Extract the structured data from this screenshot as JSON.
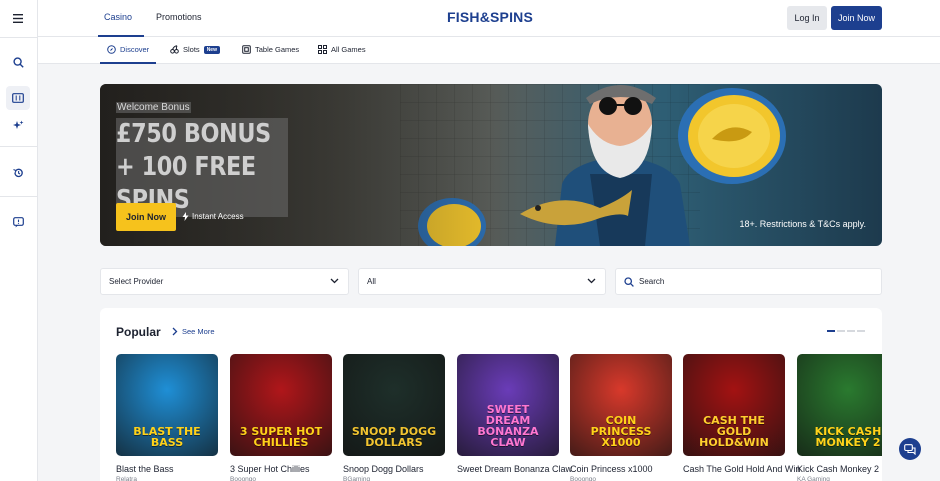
{
  "nav": {
    "tabs": [
      {
        "label": "Casino",
        "active": true
      },
      {
        "label": "Promotions",
        "active": false
      }
    ],
    "logo": "FISH&SPINS",
    "login_label": "Log In",
    "join_label": "Join Now"
  },
  "rail": {
    "icons": [
      "menu-icon",
      "search-icon",
      "slot-machine-icon",
      "sparkle-icon",
      "history-icon",
      "chat-help-icon"
    ]
  },
  "subnav": {
    "items": [
      {
        "label": "Discover",
        "icon": "compass-icon",
        "active": true
      },
      {
        "label": "Slots",
        "icon": "cherry-icon",
        "badge": "New"
      },
      {
        "label": "Table Games",
        "icon": "table-icon"
      },
      {
        "label": "All Games",
        "icon": "grid-icon"
      }
    ]
  },
  "hero": {
    "kicker": "Welcome Bonus",
    "title": "£750 BONUS + 100 FREE SPINS",
    "cta": "Join Now",
    "instant": "Instant Access",
    "terms": "18+. Restrictions & T&Cs apply."
  },
  "filters": {
    "provider": "Select Provider",
    "category": "All",
    "search_placeholder": "Search"
  },
  "popular": {
    "title": "Popular",
    "see_more": "See More",
    "games": [
      {
        "name": "Blast the Bass",
        "provider": "Relatra",
        "art": "BLAST THE BASS",
        "bg": "#1f8fd6",
        "fg": "#ffd21a"
      },
      {
        "name": "3 Super Hot Chillies",
        "provider": "Booongo",
        "art": "3 SUPER HOT CHILLIES",
        "bg": "#b0161a",
        "fg": "#ffd21a"
      },
      {
        "name": "Snoop Dogg Dollars",
        "provider": "BGaming",
        "art": "SNOOP DOGG DOLLARS",
        "bg": "#1e2f2a",
        "fg": "#f2c430"
      },
      {
        "name": "Sweet Dream Bonanza Claw",
        "provider": "",
        "art": "SWEET DREAM BONANZA CLAW",
        "bg": "#6a3cb8",
        "fg": "#ff77d1"
      },
      {
        "name": "Coin Princess x1000",
        "provider": "Booongo",
        "art": "COIN PRINCESS X1000",
        "bg": "#d8392b",
        "fg": "#ffd21a"
      },
      {
        "name": "Cash The Gold Hold And Win",
        "provider": "",
        "art": "CASH THE GOLD HOLD&WIN",
        "bg": "#a31212",
        "fg": "#ffcf2e"
      },
      {
        "name": "Kick Cash Monkey 2",
        "provider": "KA Gaming",
        "art": "KICK CASH MONKEY 2",
        "bg": "#2a7a2f",
        "fg": "#ffd21a"
      }
    ]
  },
  "colors": {
    "brand": "#1d3f8f",
    "accent": "#f6c21c"
  }
}
